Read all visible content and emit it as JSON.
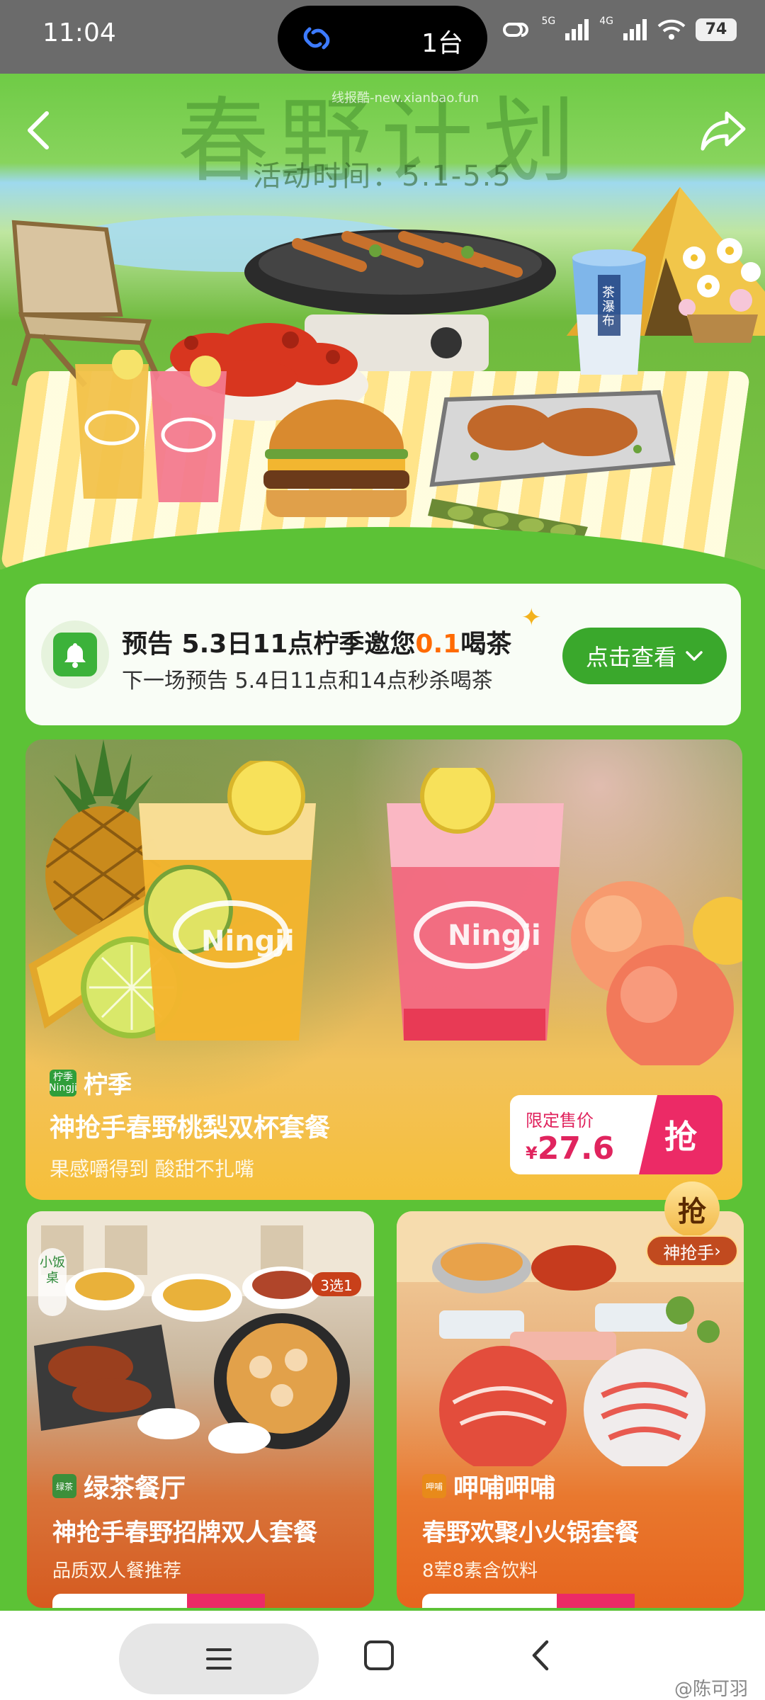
{
  "status_bar": {
    "time": "11:04",
    "island_text": "1台",
    "signal_5g": "5G",
    "signal_4g": "4G",
    "battery": "74"
  },
  "hero": {
    "deco_title": "春野计划",
    "watermark": "线报酷-new.xianbao.fun",
    "date": "活动时间：5.1-5.5",
    "cup_label": "茶瀑布"
  },
  "notice": {
    "title_prefix": "预告 5.3日11点柠季邀您",
    "title_highlight": "0.1",
    "title_suffix": "喝茶",
    "subtitle": "下一场预告 5.4日11点和14点秒杀喝茶",
    "button_label": "点击查看"
  },
  "main_card": {
    "brand_logo": "柠季 Ningji",
    "brand": "柠季",
    "title": "神抢手春野桃梨双杯套餐",
    "desc": "果感嚼得到 酸甜不扎嘴",
    "price_label": "限定售价",
    "currency": "¥",
    "price": "27.6",
    "grab_label": "抢",
    "cup_brand": "Ningji"
  },
  "cards": [
    {
      "brand": "绿茶餐厅",
      "logo": "绿茶",
      "side_brand": "小饭桌",
      "badge": "3选1",
      "title": "神抢手春野招牌双人套餐",
      "desc": "品质双人餐推荐"
    },
    {
      "brand": "呷哺呷哺",
      "logo": "呷哺",
      "grab_bubble": "抢",
      "grab_tag": "神抢手",
      "title": "春野欢聚小火锅套餐",
      "desc": "8荤8素含饮料"
    }
  ],
  "watermark_bottom": "@陈可羽",
  "colors": {
    "brand_green": "#3aa82c",
    "page_green": "#5cc236",
    "accent_pink": "#ec2a66",
    "highlight_orange": "#ff6a00"
  }
}
